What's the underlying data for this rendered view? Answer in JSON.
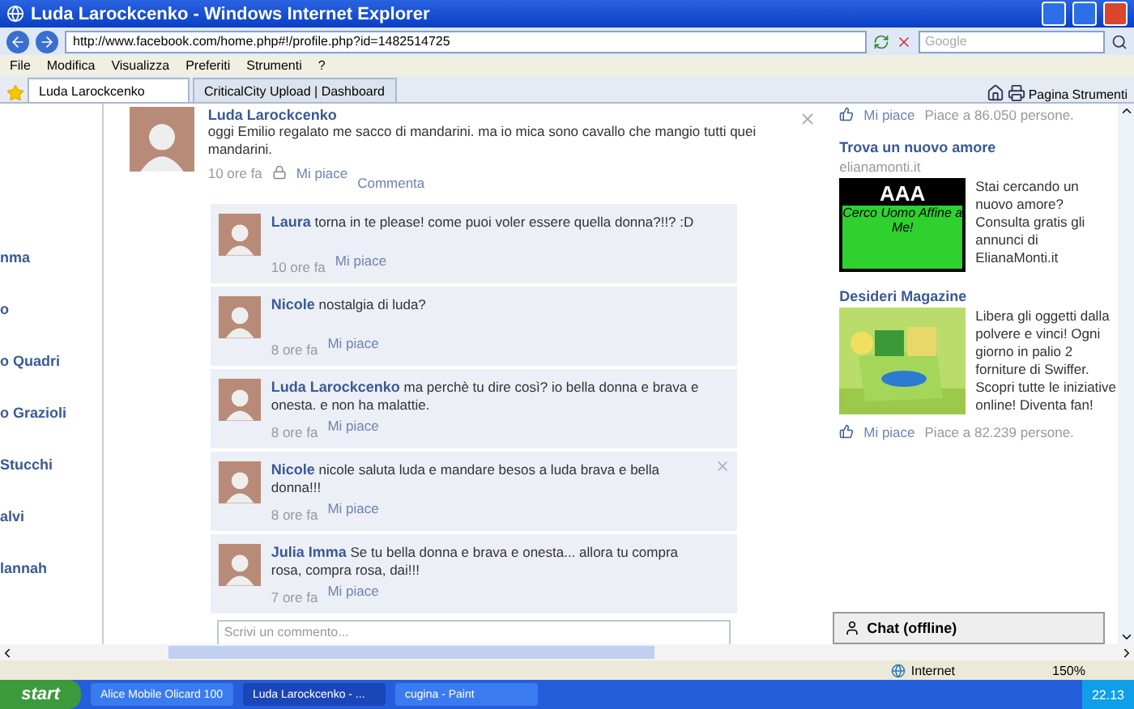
{
  "window": {
    "title": "Luda Larockcenko - Windows Internet Explorer"
  },
  "address_bar": {
    "url": "http://www.facebook.com/home.php#!/profile.php?id=1482514725",
    "search_placeholder": "Google"
  },
  "menu": [
    "File",
    "Modifica",
    "Visualizza",
    "Preferiti",
    "Strumenti",
    "?"
  ],
  "tabs": [
    {
      "label": "Luda Larockcenko",
      "selected": true
    },
    {
      "label": "CriticalCity Upload | Dashboard",
      "selected": false
    }
  ],
  "toolbar": [
    "Pagina",
    "Strumenti"
  ],
  "sidebar": {
    "items": [
      "nma",
      "o",
      "o Quadri",
      "o Grazioli",
      "Stucchi",
      "alvi",
      "lannah"
    ]
  },
  "post": {
    "author": "Luda Larockcenko",
    "text": "oggi Emilio regalato me sacco di mandarini. ma io mica sono cavallo che mangio tutti quei mandarini.",
    "time": "10 ore fa",
    "like": "Mi piace",
    "comment": "Commenta",
    "closable": true,
    "comments": [
      {
        "author": "Laura",
        "text": "torna in te please!  come puoi voler essere quella donna?!!? :D",
        "time": "10 ore fa",
        "like": "Mi piace",
        "closable": false
      },
      {
        "author": "Nicole",
        "text": "nostalgia di luda?",
        "time": "8 ore fa",
        "like": "Mi piace",
        "closable": false
      },
      {
        "author": "Luda Larockcenko",
        "text": "ma perchè tu dire così? io bella donna e brava e onesta.  e non ha malattie.",
        "time": "8 ore fa",
        "like": "Mi piace",
        "closable": false
      },
      {
        "author": "Nicole",
        "text": "nicole saluta luda e mandare besos a luda brava e bella donna!!!",
        "time": "8 ore fa",
        "like": "Mi piace",
        "closable": true
      },
      {
        "author": "Julia Imma",
        "text": "Se tu bella donna e brava e onesta... allora tu compra rosa, compra rosa, dai!!!",
        "time": "7 ore fa",
        "like": "Mi piace",
        "closable": false
      }
    ],
    "comment_placeholder": "Scrivi un commento..."
  },
  "ads": {
    "top_like": "Mi piace",
    "top_count": "Piace a 86.050 persone.",
    "items": [
      {
        "title": "Trova un nuovo amore",
        "domain": "elianamonti.it",
        "banner": [
          "AAA",
          "Cerco Uomo Affine a Me!"
        ],
        "text": "Stai cercando un nuovo amore? Consulta gratis gli annunci di ElianaMonti.it"
      },
      {
        "title": "Desideri Magazine",
        "kind": "picture",
        "text": "Libera gli oggetti dalla polvere e vinci! Ogni giorno in palio 2 forniture di Swiffer. Scopri tutte le iniziative online! Diventa fan!",
        "like": "Mi piace",
        "count": "Piace a 82.239 persone."
      }
    ]
  },
  "chat": {
    "label": "Chat (offline)"
  },
  "status_bar": {
    "zone": "Internet",
    "zoom": "150%"
  },
  "taskbar": {
    "start": "start",
    "items": [
      "Alice Mobile Olicard 100",
      "Luda Larockcenko - ...",
      "cugina - Paint"
    ],
    "clock": "22.13"
  }
}
